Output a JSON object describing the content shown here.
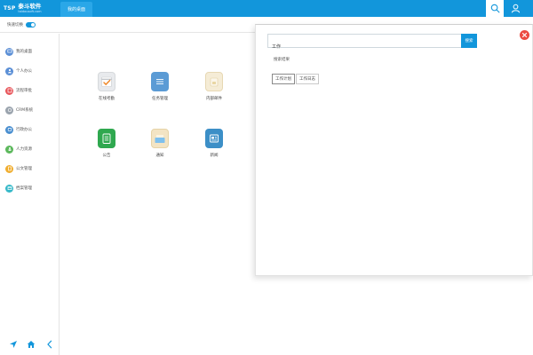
{
  "header": {
    "logo_mark": "TSP",
    "brand_title": "泰斗软件",
    "brand_subtitle": "taidousoft.com",
    "active_tab": "我的桌面"
  },
  "quick": {
    "label": "快速切换",
    "enabled": true
  },
  "sidebar": {
    "items": [
      {
        "label": "我的桌面",
        "color": "#5b8fd6",
        "icon": "desktop-icon"
      },
      {
        "label": "个人办公",
        "color": "#5b8fd6",
        "icon": "person-icon"
      },
      {
        "label": "流程审批",
        "color": "#e8555a",
        "icon": "flow-icon"
      },
      {
        "label": "CRM系统",
        "color": "#9aa3ad",
        "icon": "crm-icon"
      },
      {
        "label": "行政办公",
        "color": "#4a8fd0",
        "icon": "admin-icon"
      },
      {
        "label": "人力资源",
        "color": "#5cb85c",
        "icon": "hr-icon"
      },
      {
        "label": "公文管理",
        "color": "#f0ad2e",
        "icon": "document-icon"
      },
      {
        "label": "档案管理",
        "color": "#34b8c8",
        "icon": "archive-icon"
      }
    ]
  },
  "apps": [
    {
      "label": "在线考勤",
      "color": "#e8eaed",
      "icon": "attendance-icon"
    },
    {
      "label": "任务管理",
      "color": "#5b9bd5",
      "icon": "task-icon"
    },
    {
      "label": "内部邮件",
      "color": "#f5ecd6",
      "icon": "mail-icon"
    },
    {
      "label": "公告",
      "color": "#2fa84f",
      "icon": "notice-icon"
    },
    {
      "label": "通知",
      "color": "#f3e4c4",
      "icon": "notify-icon"
    },
    {
      "label": "新闻",
      "color": "#3c8fc7",
      "icon": "news-icon"
    }
  ],
  "search": {
    "query": "工作",
    "button_label": "搜索",
    "results_title": "搜索结果",
    "results": [
      "工作计划",
      "工作日志"
    ]
  }
}
